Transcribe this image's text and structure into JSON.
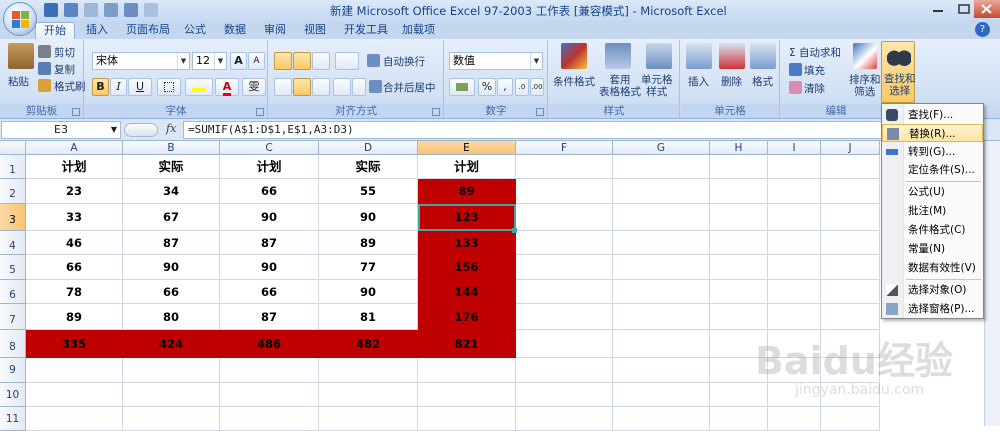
{
  "window": {
    "title": "新建 Microsoft Office Excel 97-2003 工作表  [兼容模式] - Microsoft Excel"
  },
  "tabs": [
    "开始",
    "插入",
    "页面布局",
    "公式",
    "数据",
    "审阅",
    "视图",
    "开发工具",
    "加载项"
  ],
  "ribbon": {
    "clipboard": {
      "label": "剪贴板",
      "paste": "粘贴",
      "cut": "剪切",
      "copy": "复制",
      "format_painter": "格式刷"
    },
    "font": {
      "label": "字体",
      "font_name": "宋体",
      "font_size": "12",
      "bold": "B",
      "italic": "I",
      "underline": "U",
      "grow": "A",
      "shrink": "A",
      "color_a": "A",
      "phonetic": "雯"
    },
    "alignment": {
      "label": "对齐方式",
      "wrap": "自动换行",
      "merge": "合并后居中"
    },
    "number": {
      "label": "数字",
      "format": "数值",
      "percent": "%",
      "comma": ","
    },
    "styles": {
      "label": "样式",
      "cond_format": "条件格式",
      "table_format": "套用\n表格格式",
      "cell_style": "单元格\n样式"
    },
    "cells": {
      "label": "单元格",
      "insert": "插入",
      "delete": "删除",
      "format": "格式"
    },
    "editing": {
      "label": "编辑",
      "autosum": "Σ 自动求和",
      "fill": "填充",
      "clear": "清除",
      "sort_filter": "排序和\n筛选",
      "find_select": "查找和\n选择"
    }
  },
  "formula_bar": {
    "name_box": "E3",
    "fx": "fx",
    "formula": "=SUMIF(A$1:D$1,E$1,A3:D3)"
  },
  "grid": {
    "columns": [
      "A",
      "B",
      "C",
      "D",
      "E",
      "F",
      "G",
      "H",
      "I",
      "J"
    ],
    "rows": [
      "1",
      "2",
      "3",
      "4",
      "5",
      "6",
      "7",
      "8",
      "9",
      "10",
      "11"
    ],
    "header_row": [
      "计划",
      "实际",
      "计划",
      "实际",
      "计划"
    ],
    "data": [
      [
        "23",
        "34",
        "66",
        "55",
        "89"
      ],
      [
        "33",
        "67",
        "90",
        "90",
        "123"
      ],
      [
        "46",
        "87",
        "87",
        "89",
        "133"
      ],
      [
        "66",
        "90",
        "90",
        "77",
        "156"
      ],
      [
        "78",
        "66",
        "66",
        "90",
        "144"
      ],
      [
        "89",
        "80",
        "87",
        "81",
        "176"
      ],
      [
        "335",
        "424",
        "486",
        "482",
        "821"
      ]
    ],
    "active_cell": "E3",
    "highlight_color": "#c00000"
  },
  "dropdown_menu": {
    "items": [
      "查找(F)...",
      "替换(R)...",
      "转到(G)...",
      "定位条件(S)...",
      "公式(U)",
      "批注(M)",
      "条件格式(C)",
      "常量(N)",
      "数据有效性(V)",
      "选择对象(O)",
      "选择窗格(P)..."
    ],
    "highlighted": "替换(R)..."
  },
  "watermark": {
    "text": "Baidu经验",
    "url": "jingyan.baidu.com"
  }
}
